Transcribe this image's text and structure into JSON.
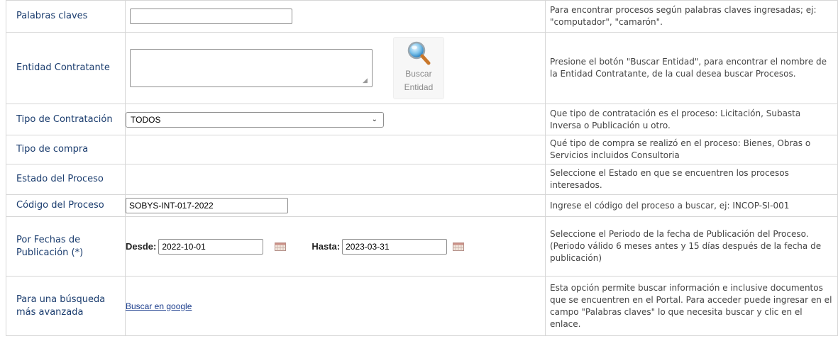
{
  "rows": {
    "keywords": {
      "label": "Palabras claves",
      "value": "",
      "help": "Para encontrar procesos según palabras claves ingresadas; ej: \"computador\", \"camarón\"."
    },
    "entity": {
      "label": "Entidad Contratante",
      "button_line1": "Buscar",
      "button_line2": "Entidad",
      "help": "Presione el botón \"Buscar Entidad\", para encontrar el nombre de la Entidad Contratante, de la cual desea buscar Procesos."
    },
    "contract_type": {
      "label": "Tipo de Contratación",
      "selected": "TODOS",
      "help": "Que tipo de contratación es el proceso: Licitación, Subasta Inversa o Publicación u otro."
    },
    "purchase_type": {
      "label": "Tipo de compra",
      "help": "Qué tipo de compra se realizó en el proceso: Bienes, Obras o Servicios incluidos Consultoria"
    },
    "process_state": {
      "label": "Estado del Proceso",
      "help": "Seleccione el Estado en que se encuentren los procesos interesados."
    },
    "process_code": {
      "label": "Código del Proceso",
      "value": "SOBYS-INT-017-2022",
      "help": "Ingrese el código del proceso a buscar, ej: INCOP-SI-001"
    },
    "dates": {
      "label": "Por Fechas de Publicación (*)",
      "from_label": "Desde:",
      "from_value": "2022-10-01",
      "to_label": "Hasta:",
      "to_value": "2023-03-31",
      "help_line1": "Seleccione el Periodo de la fecha de Publicación del Proceso.",
      "help_line2": "(Periodo válido 6 meses antes y 15 días después de la fecha de publicación)"
    },
    "advanced": {
      "label": "Para una búsqueda más avanzada",
      "link": "Buscar en google",
      "help": "Esta opción permite buscar información e inclusive documentos que se encuentren en el Portal. Para acceder puede ingresar en el campo \"Palabras claves\" lo que necesita buscar y clic en el enlace."
    }
  },
  "icons": {
    "search": "magnifier-icon",
    "calendar": "calendar-icon",
    "dropdown": "chevron-down-icon"
  },
  "colors": {
    "label": "#1a3c6e",
    "link": "#1a3c8c",
    "border": "#d6d6d6"
  }
}
